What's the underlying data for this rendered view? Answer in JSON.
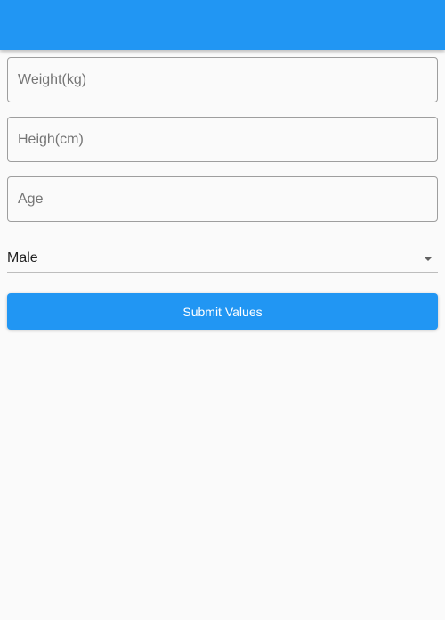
{
  "colors": {
    "primary": "#2196f3",
    "background": "#fafafa"
  },
  "form": {
    "weight": {
      "placeholder": "Weight(kg)",
      "value": ""
    },
    "height": {
      "placeholder": "Heigh(cm)",
      "value": ""
    },
    "age": {
      "placeholder": "Age",
      "value": ""
    },
    "gender": {
      "selected": "Male",
      "icon": "arrow-drop-down-icon"
    },
    "submit_label": "Submit Values"
  }
}
